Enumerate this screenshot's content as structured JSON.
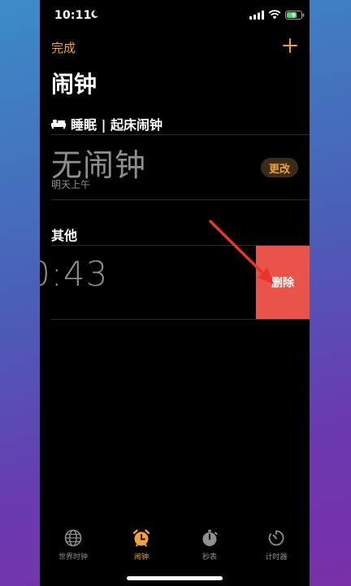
{
  "status_bar": {
    "time": "10:11"
  },
  "header": {
    "done_label": "完成",
    "title": "闹钟"
  },
  "sleep": {
    "section_label": "睡眠 | 起床闹钟",
    "no_alarm": "无闹钟",
    "subtitle": "明天上午",
    "change_label": "更改"
  },
  "others": {
    "section_label": "其他",
    "alarm_time_visible": "0:43",
    "delete_label": "删除"
  },
  "tabs": [
    {
      "label": "世界时钟",
      "icon": "globe-icon",
      "active": false
    },
    {
      "label": "闹钟",
      "icon": "alarm-clock-icon",
      "active": true
    },
    {
      "label": "秒表",
      "icon": "stopwatch-icon",
      "active": false
    },
    {
      "label": "计时器",
      "icon": "timer-icon",
      "active": false
    }
  ],
  "colors": {
    "accent": "#f0a03c",
    "delete": "#e8534a",
    "annotation_arrow": "#e8342c"
  }
}
